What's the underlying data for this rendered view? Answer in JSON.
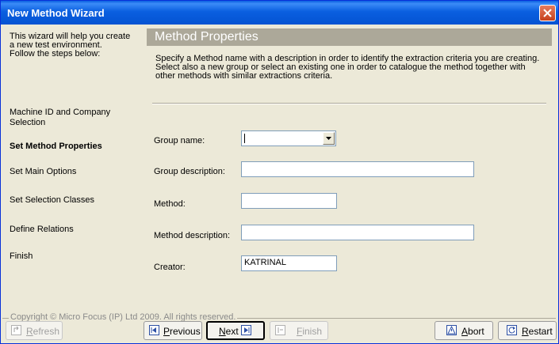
{
  "window": {
    "title": "New Method Wizard"
  },
  "left": {
    "intro_lines": [
      "This wizard will help you create",
      "a new test environment.",
      "Follow the steps below:"
    ],
    "steps": [
      {
        "lines": [
          "Machine ID and Company",
          "Selection"
        ]
      },
      {
        "lines": [
          "Set Method Properties"
        ],
        "current": true
      },
      {
        "lines": [
          "Set Main Options"
        ]
      },
      {
        "lines": [
          "Set Selection Classes"
        ]
      },
      {
        "lines": [
          "Define Relations"
        ]
      },
      {
        "lines": [
          "Finish"
        ]
      }
    ]
  },
  "main": {
    "header": "Method Properties",
    "description_lines": [
      "Specify a Method name with a description in order to identify the extraction criteria you are creating.",
      "Select also a new group or select an existing one in order to catalogue the method together with",
      "other methods with similar extractions criteria."
    ],
    "fields": {
      "group_name": {
        "label": "Group name:",
        "value": ""
      },
      "group_description": {
        "label": "Group description:",
        "value": ""
      },
      "method": {
        "label": "Method:",
        "value": ""
      },
      "method_description": {
        "label": "Method description:",
        "value": ""
      },
      "creator": {
        "label": "Creator:",
        "value": "KATRINAL"
      }
    }
  },
  "footer": {
    "copyright": "Copyright © Micro Focus (IP) Ltd 2009. All rights reserved.",
    "buttons": {
      "refresh": {
        "label": "Refresh",
        "mnemonic": "R",
        "rest": "efresh"
      },
      "previous": {
        "label": "Previous",
        "mnemonic": "P",
        "rest": "revious"
      },
      "next": {
        "label": "Next",
        "mnemonic": "N",
        "rest": "ext"
      },
      "finish": {
        "label": "Finish",
        "mnemonic": "F",
        "rest": "inish"
      },
      "abort": {
        "label": "Abort",
        "mnemonic": "A",
        "rest": "bort"
      },
      "restart": {
        "label": "Restart",
        "mnemonic": "R",
        "rest": "estart"
      }
    }
  }
}
